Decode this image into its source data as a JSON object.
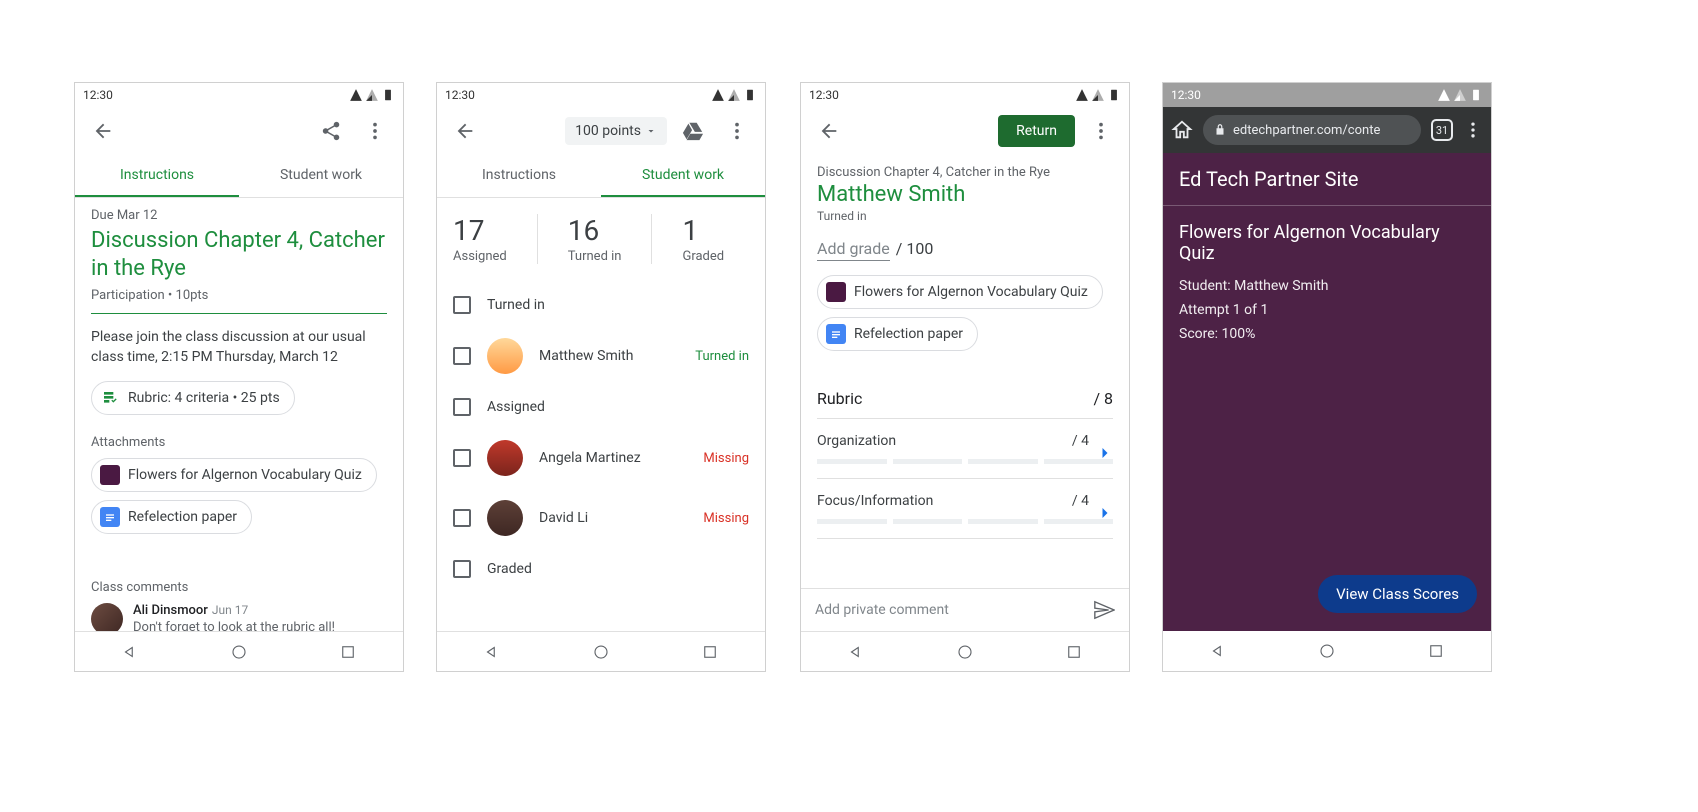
{
  "status_time": "12:30",
  "screen1": {
    "tabs": {
      "instructions": "Instructions",
      "studentwork": "Student work"
    },
    "due": "Due Mar 12",
    "title": "Discussion Chapter 4, Catcher in the Rye",
    "meta": "Participation • 10pts",
    "description": "Please join the class discussion at our usual class time, 2:15 PM Thursday, March 12",
    "rubric_chip": "Rubric: 4 criteria • 25 pts",
    "attachments_label": "Attachments",
    "attachments": [
      {
        "label": "Flowers for Algernon Vocabulary Quiz",
        "icon": "purple"
      },
      {
        "label": "Refelection paper",
        "icon": "blue"
      }
    ],
    "comments_label": "Class comments",
    "comment": {
      "author": "Ali Dinsmoor",
      "date": "Jun 17",
      "text": "Don't forget to look at the rubric all!"
    }
  },
  "screen2": {
    "points_label": "100 points",
    "tabs": {
      "instructions": "Instructions",
      "studentwork": "Student work"
    },
    "stats": [
      {
        "num": "17",
        "label": "Assigned"
      },
      {
        "num": "16",
        "label": "Turned in"
      },
      {
        "num": "1",
        "label": "Graded"
      }
    ],
    "sections": {
      "turnedin": "Turned in",
      "assigned": "Assigned",
      "graded": "Graded"
    },
    "students": {
      "matthew": {
        "name": "Matthew Smith",
        "status": "Turned in",
        "status_class": "turned"
      },
      "angela": {
        "name": "Angela Martinez",
        "status": "Missing",
        "status_class": "missing"
      },
      "david": {
        "name": "David Li",
        "status": "Missing",
        "status_class": "missing"
      }
    }
  },
  "screen3": {
    "return": "Return",
    "crumb": "Discussion Chapter 4, Catcher in the Rye",
    "student": "Matthew Smith",
    "status": "Turned in",
    "grade_placeholder": "Add grade",
    "grade_max": "/ 100",
    "attachments": [
      {
        "label": "Flowers for Algernon Vocabulary Quiz",
        "icon": "purple"
      },
      {
        "label": "Refelection paper",
        "icon": "blue"
      }
    ],
    "rubric_label": "Rubric",
    "rubric_total": "/ 8",
    "criteria": [
      {
        "name": "Organization",
        "max": "/ 4"
      },
      {
        "name": "Focus/Information",
        "max": "/ 4"
      }
    ],
    "comment_placeholder": "Add private comment"
  },
  "screen4": {
    "url": "edtechpartner.com/conte",
    "tabs_count": "31",
    "site_title": "Ed Tech Partner Site",
    "quiz_title": "Flowers for Algernon Vocabulary Quiz",
    "student": "Student: Matthew Smith",
    "attempt": "Attempt 1 of 1",
    "score": "Score: 100%",
    "view_button": "View Class Scores"
  }
}
